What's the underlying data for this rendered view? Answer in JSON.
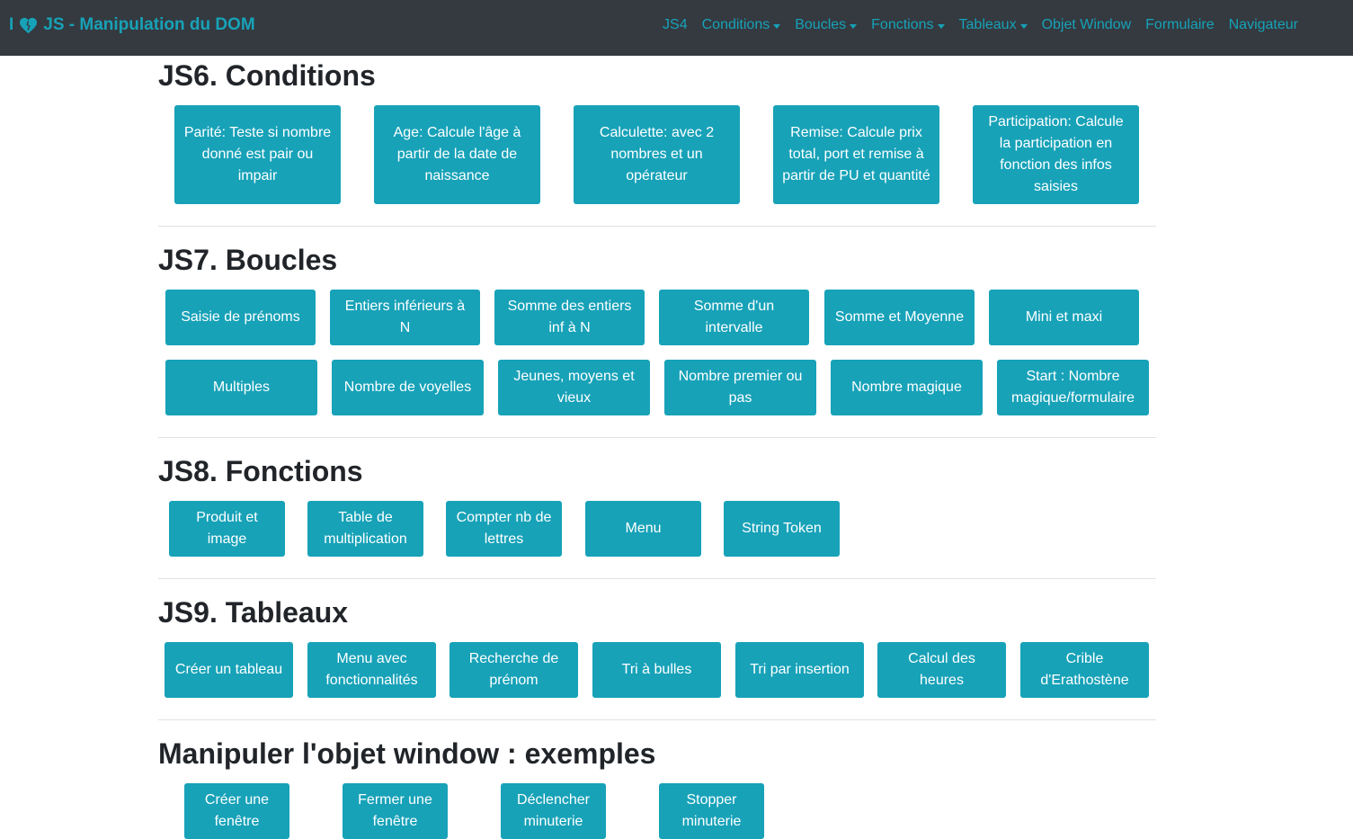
{
  "navbar": {
    "brand_prefix": "I",
    "brand_icon": "heart-icon",
    "brand_text": "JS - Manipulation du DOM",
    "links": [
      {
        "label": "JS4",
        "dropdown": false
      },
      {
        "label": "Conditions",
        "dropdown": true
      },
      {
        "label": "Boucles",
        "dropdown": true
      },
      {
        "label": "Fonctions",
        "dropdown": true
      },
      {
        "label": "Tableaux",
        "dropdown": true
      },
      {
        "label": "Objet Window",
        "dropdown": false
      },
      {
        "label": "Formulaire",
        "dropdown": false
      },
      {
        "label": "Navigateur",
        "dropdown": false
      }
    ]
  },
  "colors": {
    "navbar_bg": "#343a40",
    "accent": "#17a2b8",
    "button_text": "#ffffff"
  },
  "sections": [
    {
      "title": "JS6. Conditions",
      "buttons": [
        "Parité: Teste si nombre donné est pair ou impair",
        "Age: Calcule l'âge à partir de la date de naissance",
        "Calculette: avec 2 nombres et un opérateur",
        "Remise: Calcule prix total, port et remise à partir de PU et quantité",
        "Participation: Calcule la participation en fonction des infos saisies"
      ]
    },
    {
      "title": "JS7. Boucles",
      "buttons": [
        "Saisie de prénoms",
        "Entiers inférieurs à N",
        "Somme des entiers inf à N",
        "Somme d'un intervalle",
        "Somme et Moyenne",
        "Mini et maxi",
        "Multiples",
        "Nombre de voyelles",
        "Jeunes, moyens et vieux",
        "Nombre premier ou pas",
        "Nombre magique",
        "Start : Nombre magique/formulaire"
      ]
    },
    {
      "title": "JS8. Fonctions",
      "buttons": [
        "Produit et image",
        "Table de multiplication",
        "Compter nb de lettres",
        "Menu",
        "String Token"
      ]
    },
    {
      "title": "JS9. Tableaux",
      "buttons": [
        "Créer un tableau",
        "Menu avec fonctionnalités",
        "Recherche de prénom",
        "Tri à bulles",
        "Tri par insertion",
        "Calcul des heures",
        "Crible d'Erathostène"
      ]
    },
    {
      "title": "Manipuler l'objet window : exemples",
      "buttons": [
        "Créer une fenêtre",
        "Fermer une fenêtre",
        "Déclencher minuterie",
        "Stopper minuterie"
      ]
    }
  ]
}
